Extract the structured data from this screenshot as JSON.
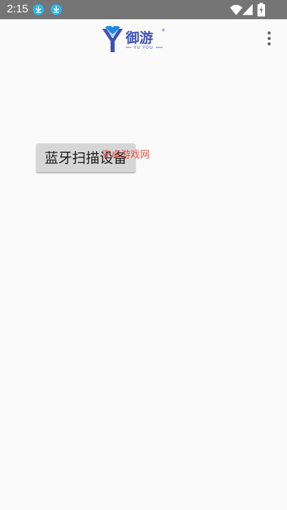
{
  "status_bar": {
    "time": "2:15",
    "notifications": [
      "download-icon",
      "download-icon"
    ],
    "indicators": [
      "wifi-icon",
      "cellular-signal-icon",
      "battery-charging-icon"
    ],
    "background_color": "#757575",
    "notification_color": "#29b6f6"
  },
  "app_bar": {
    "logo_text": "御游",
    "logo_subtext": "YU YOU",
    "logo_colors": {
      "primary": "#3f51b5",
      "secondary": "#1e88e5"
    },
    "overflow_icon": "more-vert-icon"
  },
  "main": {
    "scan_button_label": "蓝牙扫描设备"
  },
  "watermark": {
    "text": "安卓游戏网",
    "color": "#e0463a"
  }
}
